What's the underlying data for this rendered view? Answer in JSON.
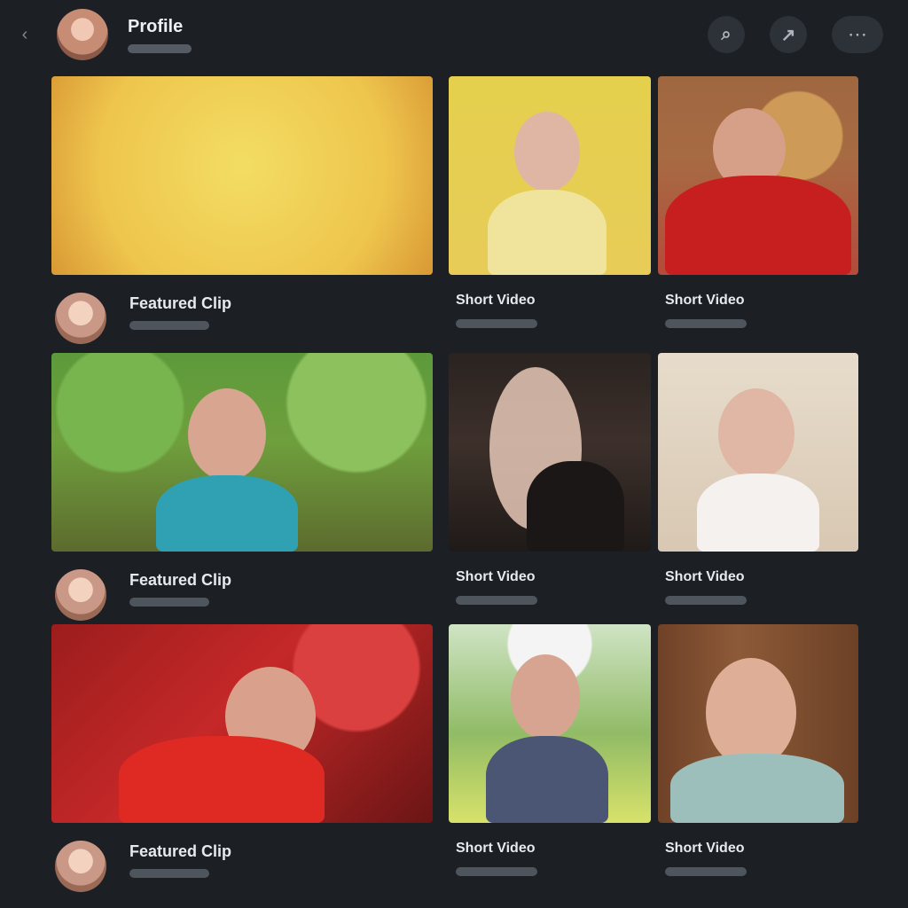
{
  "header": {
    "title": "Profile",
    "actions": [
      "search",
      "share",
      "more"
    ]
  },
  "feed": {
    "rows": [
      {
        "meta_left_title": "Featured Clip",
        "meta_mid_title": "Short Video",
        "meta_right_title": "Short Video"
      },
      {
        "meta_left_title": "Featured Clip",
        "meta_mid_title": "Short Video",
        "meta_right_title": "Short Video"
      },
      {
        "meta_left_title": "Featured Clip",
        "meta_mid_title": "Short Video",
        "meta_right_title": "Short Video"
      }
    ],
    "hero_card": {
      "headline": "",
      "number": ""
    }
  }
}
